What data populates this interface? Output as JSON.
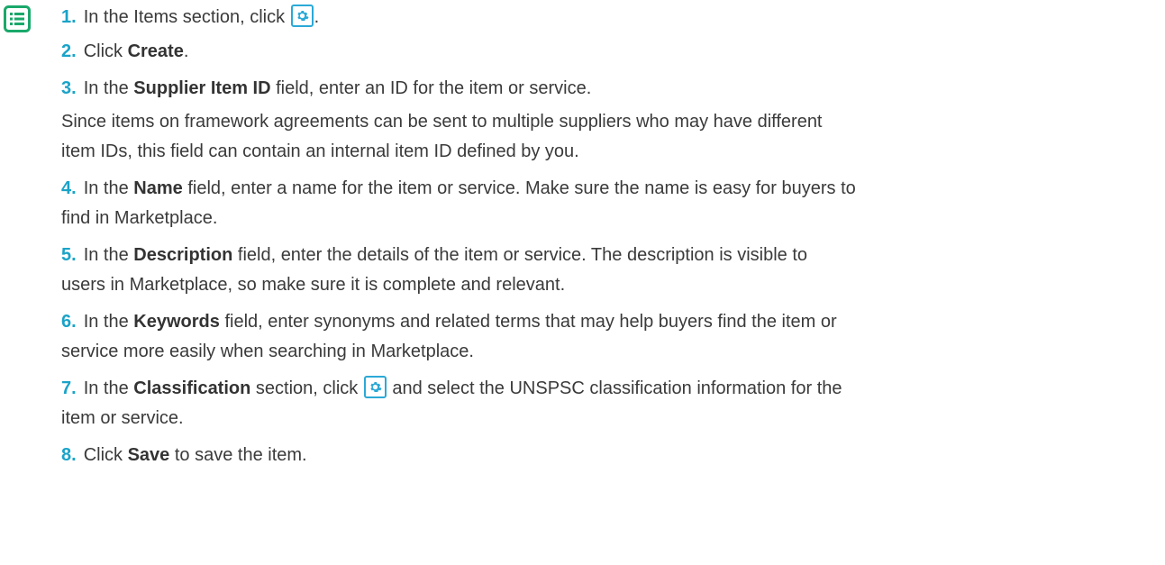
{
  "colors": {
    "accent": "#1aa3c8",
    "gear_border": "#2ba9d6",
    "text": "#3a3a3a",
    "icon": "#1aa86a"
  },
  "icons": {
    "list": "list-icon",
    "settings": "gear-icon"
  },
  "steps": [
    {
      "num": "1.",
      "pre": "In the Items section, click ",
      "post": "."
    },
    {
      "num": "2.",
      "pre": "Click ",
      "bold": "Create",
      "post": "."
    },
    {
      "num": "3.",
      "pre": "In the ",
      "bold": "Supplier Item ID",
      "post": " field, enter an ID for the item or service.",
      "note_line1": "Since items on framework agreements can be sent to multiple suppliers who may have different",
      "note_line2": "item IDs, this field can contain an internal item ID defined by you."
    },
    {
      "num": "4.",
      "pre": "In the ",
      "bold": "Name",
      "post_line1": " field, enter a name for the item or service. Make sure the name is easy for buyers to",
      "post_line2": "find in Marketplace."
    },
    {
      "num": "5.",
      "pre": "In the ",
      "bold": "Description",
      "post_line1": " field, enter the details of the item or service. The description is visible to",
      "post_line2": "users in Marketplace, so make sure it is complete and relevant."
    },
    {
      "num": "6.",
      "pre": "In the ",
      "bold": "Keywords",
      "post_line1": " field, enter synonyms and related terms that may help buyers find the item or",
      "post_line2": "service more easily when searching in Marketplace."
    },
    {
      "num": "7.",
      "pre": "In the ",
      "bold": "Classification",
      "mid": " section, click ",
      "post_line1": " and select the UNSPSC classification information for the",
      "post_line2": "item or service."
    },
    {
      "num": "8.",
      "pre": "Click ",
      "bold": "Save",
      "post": " to save the item."
    }
  ]
}
